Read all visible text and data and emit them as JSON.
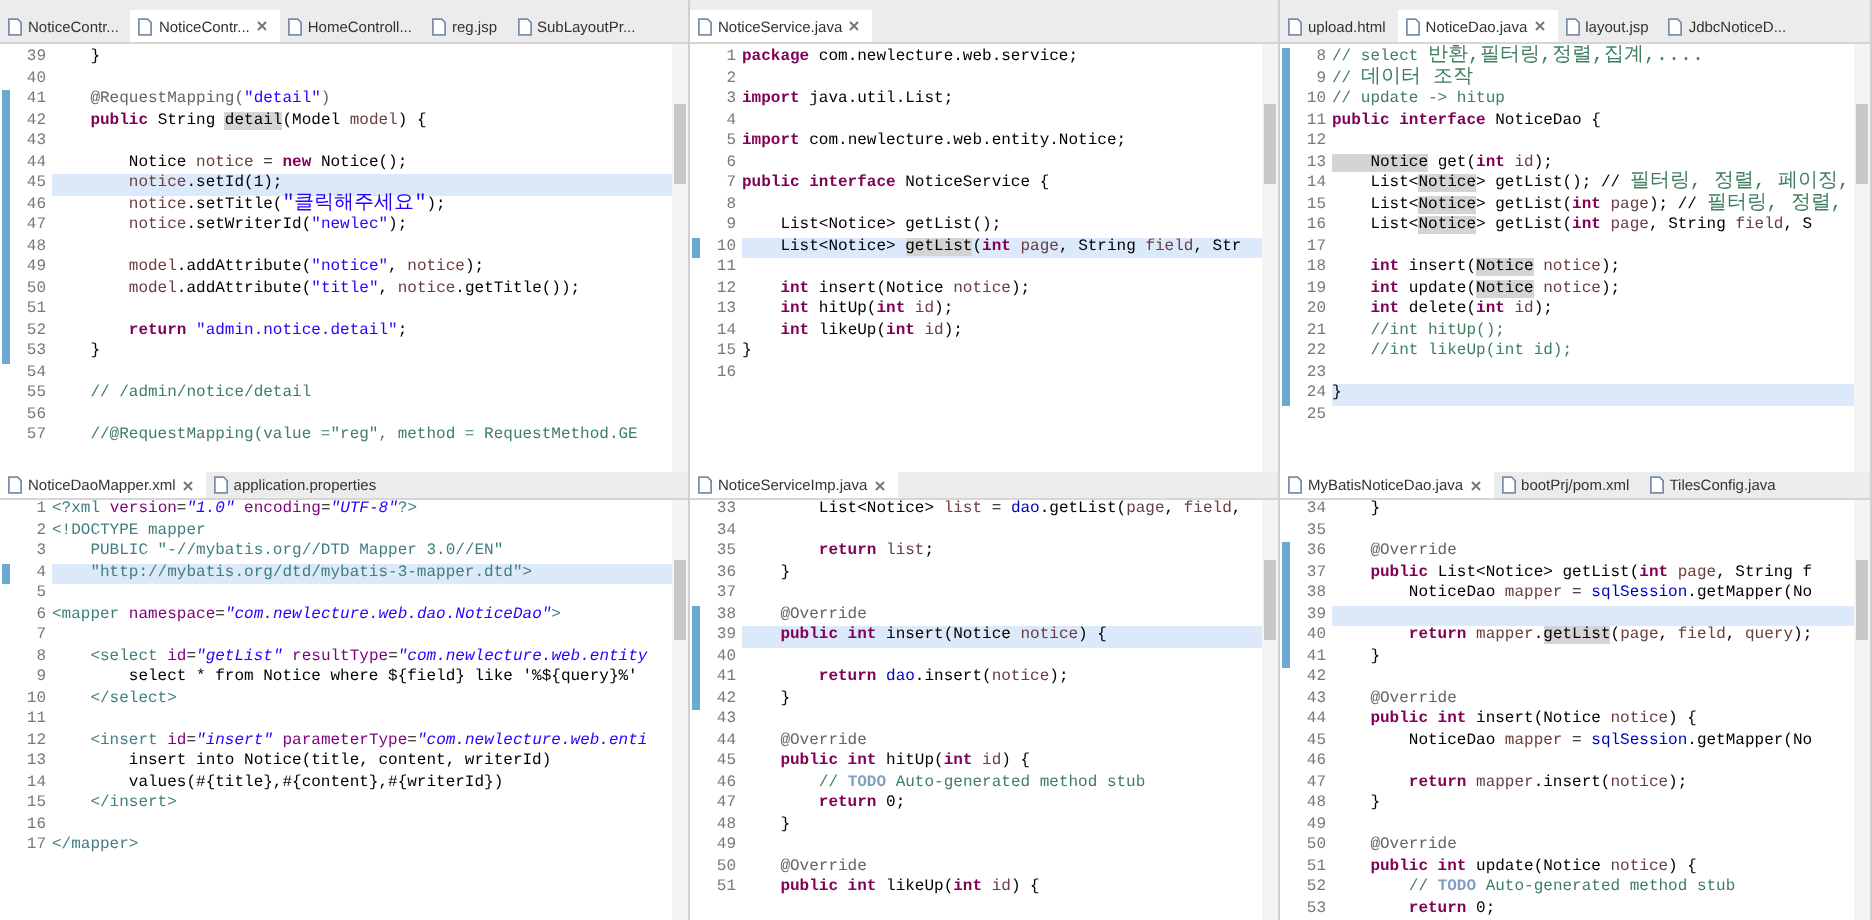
{
  "panes": [
    {
      "tabs": [
        {
          "label": "NoticeContr...",
          "selected": false
        },
        {
          "label": "NoticeContr...",
          "selected": true
        },
        {
          "label": "HomeControll...",
          "selected": false
        },
        {
          "label": "reg.jsp",
          "selected": false
        },
        {
          "label": "SubLayoutPr...",
          "selected": false
        }
      ],
      "lines": [
        {
          "n": "39",
          "changed": false,
          "current": false,
          "code": [
            {
              "text": "    }",
              "kind": "plain"
            }
          ]
        },
        {
          "n": "40",
          "changed": false,
          "current": false
        },
        {
          "n": "41",
          "changed": true,
          "current": false,
          "code": [
            {
              "text": "    @RequestMapping(",
              "kind": "annotation"
            },
            {
              "text": "\"detail\"",
              "kind": "string"
            },
            {
              "text": ")",
              "kind": "annotation"
            }
          ]
        },
        {
          "n": "42",
          "changed": true,
          "current": false,
          "code": [
            {
              "text": "    public",
              "kind": "keyword"
            },
            {
              "text": " String ",
              "kind": "plain"
            },
            {
              "text": "detail",
              "kind": "occurrence"
            },
            {
              "text": "(Model ",
              "kind": "plain"
            },
            {
              "text": "model",
              "kind": "variable"
            },
            {
              "text": ") {",
              "kind": "plain"
            }
          ]
        },
        {
          "n": "43",
          "changed": true,
          "current": false
        },
        {
          "n": "44",
          "changed": true,
          "current": false,
          "code": [
            {
              "text": "        Notice ",
              "kind": "plain"
            },
            {
              "text": "notice",
              "kind": "variable"
            },
            {
              "text": " = ",
              "kind": "plain"
            },
            {
              "text": "new",
              "kind": "keyword"
            },
            {
              "text": " Notice();",
              "kind": "plain"
            }
          ]
        },
        {
          "n": "45",
          "changed": true,
          "current": true,
          "code": [
            {
              "text": "        notice",
              "kind": "variable"
            },
            {
              "text": ".setId(1);",
              "kind": "plain"
            }
          ]
        },
        {
          "n": "46",
          "changed": true,
          "current": false,
          "code": [
            {
              "text": "        notice",
              "kind": "variable"
            },
            {
              "text": ".setTitle(",
              "kind": "plain"
            },
            {
              "text": "\"클릭해주세요\"",
              "kind": "korean-string"
            },
            {
              "text": ");",
              "kind": "plain"
            }
          ]
        },
        {
          "n": "47",
          "changed": true,
          "current": false,
          "code": [
            {
              "text": "        notice",
              "kind": "variable"
            },
            {
              "text": ".setWriterId(",
              "kind": "plain"
            },
            {
              "text": "\"newlec\"",
              "kind": "string"
            },
            {
              "text": ");",
              "kind": "plain"
            }
          ]
        },
        {
          "n": "48",
          "changed": true,
          "current": false
        },
        {
          "n": "49",
          "changed": true,
          "current": false,
          "code": [
            {
              "text": "        model",
              "kind": "variable"
            },
            {
              "text": ".addAttribute(",
              "kind": "plain"
            },
            {
              "text": "\"notice\"",
              "kind": "string"
            },
            {
              "text": ", ",
              "kind": "plain"
            },
            {
              "text": "notice",
              "kind": "variable"
            },
            {
              "text": ");",
              "kind": "plain"
            }
          ]
        },
        {
          "n": "50",
          "changed": true,
          "current": false,
          "code": [
            {
              "text": "        model",
              "kind": "variable"
            },
            {
              "text": ".addAttribute(",
              "kind": "plain"
            },
            {
              "text": "\"title\"",
              "kind": "string"
            },
            {
              "text": ", ",
              "kind": "plain"
            },
            {
              "text": "notice",
              "kind": "variable"
            },
            {
              "text": ".getTitle());",
              "kind": "plain"
            }
          ]
        },
        {
          "n": "51",
          "changed": true,
          "current": false
        },
        {
          "n": "52",
          "changed": true,
          "current": false,
          "code": [
            {
              "text": "        return",
              "kind": "keyword"
            },
            {
              "text": " \"admin.notice.detail\"",
              "kind": "string"
            },
            {
              "text": ";",
              "kind": "plain"
            }
          ]
        },
        {
          "n": "53",
          "changed": true,
          "current": false,
          "code": [
            {
              "text": "    }",
              "kind": "plain"
            }
          ]
        },
        {
          "n": "54",
          "changed": false,
          "current": false
        },
        {
          "n": "55",
          "changed": false,
          "current": false,
          "code": [
            {
              "text": "    // /admin/notice/detail",
              "kind": "comment"
            }
          ]
        },
        {
          "n": "56",
          "changed": false,
          "current": false
        },
        {
          "n": "57",
          "changed": false,
          "current": false,
          "code": [
            {
              "text": "    //@RequestMapping(value =\"reg\", method = RequestMethod.GE",
              "kind": "comment"
            }
          ]
        }
      ]
    },
    {
      "tabs": [
        {
          "label": "NoticeService.java",
          "selected": true
        }
      ],
      "lines": [
        {
          "n": "1",
          "changed": false,
          "current": false,
          "code": [
            {
              "text": "package",
              "kind": "keyword"
            },
            {
              "text": " com.newlecture.web.service;",
              "kind": "plain"
            }
          ]
        },
        {
          "n": "2",
          "changed": false,
          "current": false
        },
        {
          "n": "3",
          "changed": false,
          "current": false,
          "code": [
            {
              "text": "import",
              "kind": "keyword"
            },
            {
              "text": " java.util.List;",
              "kind": "plain"
            }
          ]
        },
        {
          "n": "4",
          "changed": false,
          "current": false
        },
        {
          "n": "5",
          "changed": false,
          "current": false,
          "code": [
            {
              "text": "import",
              "kind": "keyword"
            },
            {
              "text": " com.newlecture.web.entity.Notice;",
              "kind": "plain"
            }
          ]
        },
        {
          "n": "6",
          "changed": false,
          "current": false
        },
        {
          "n": "7",
          "changed": false,
          "current": false,
          "code": [
            {
              "text": "public interface",
              "kind": "keyword"
            },
            {
              "text": " NoticeService {",
              "kind": "plain"
            }
          ]
        },
        {
          "n": "8",
          "changed": false,
          "current": false
        },
        {
          "n": "9",
          "changed": false,
          "current": false,
          "code": [
            {
              "text": "    List<Notice> getList();",
              "kind": "plain"
            }
          ]
        },
        {
          "n": "10",
          "changed": true,
          "current": true,
          "code": [
            {
              "text": "    List<Notice> ",
              "kind": "plain"
            },
            {
              "text": "getList",
              "kind": "occurrence"
            },
            {
              "text": "(",
              "kind": "plain"
            },
            {
              "text": "int",
              "kind": "keyword"
            },
            {
              "text": " page",
              "kind": "variable"
            },
            {
              "text": ", String ",
              "kind": "plain"
            },
            {
              "text": "field",
              "kind": "variable"
            },
            {
              "text": ", Str",
              "kind": "plain"
            }
          ]
        },
        {
          "n": "11",
          "changed": false,
          "current": false
        },
        {
          "n": "12",
          "changed": false,
          "current": false,
          "code": [
            {
              "text": "    int",
              "kind": "keyword"
            },
            {
              "text": " insert(Notice ",
              "kind": "plain"
            },
            {
              "text": "notice",
              "kind": "variable"
            },
            {
              "text": ");",
              "kind": "plain"
            }
          ]
        },
        {
          "n": "13",
          "changed": false,
          "current": false,
          "code": [
            {
              "text": "    int",
              "kind": "keyword"
            },
            {
              "text": " hitUp(",
              "kind": "plain"
            },
            {
              "text": "int",
              "kind": "keyword"
            },
            {
              "text": " id",
              "kind": "variable"
            },
            {
              "text": ");",
              "kind": "plain"
            }
          ]
        },
        {
          "n": "14",
          "changed": false,
          "current": false,
          "code": [
            {
              "text": "    int",
              "kind": "keyword"
            },
            {
              "text": " likeUp(",
              "kind": "plain"
            },
            {
              "text": "int",
              "kind": "keyword"
            },
            {
              "text": " id",
              "kind": "variable"
            },
            {
              "text": ");",
              "kind": "plain"
            }
          ]
        },
        {
          "n": "15",
          "changed": false,
          "current": false,
          "code": [
            {
              "text": "}",
              "kind": "plain"
            }
          ]
        },
        {
          "n": "16",
          "changed": false,
          "current": false
        }
      ]
    },
    {
      "tabs": [
        {
          "label": "upload.html",
          "selected": false
        },
        {
          "label": "NoticeDao.java",
          "selected": true
        },
        {
          "label": "layout.jsp",
          "selected": false
        },
        {
          "label": "JdbcNoticeD...",
          "selected": false
        }
      ],
      "lines": [
        {
          "n": "8",
          "changed": true,
          "current": false,
          "code": [
            {
              "text": "// select ",
              "kind": "comment"
            },
            {
              "text": "반환,필터링,정렬,집계,....",
              "kind": "korean-comment"
            }
          ]
        },
        {
          "n": "9",
          "changed": true,
          "current": false,
          "code": [
            {
              "text": "// ",
              "kind": "comment"
            },
            {
              "text": "데이터 조작",
              "kind": "korean-comment"
            }
          ]
        },
        {
          "n": "10",
          "changed": true,
          "current": false,
          "code": [
            {
              "text": "// update -> hitup",
              "kind": "comment"
            }
          ]
        },
        {
          "n": "11",
          "changed": true,
          "current": false,
          "code": [
            {
              "text": "public interface",
              "kind": "keyword"
            },
            {
              "text": " NoticeDao {",
              "kind": "plain"
            }
          ]
        },
        {
          "n": "12",
          "changed": true,
          "current": false
        },
        {
          "n": "13",
          "changed": true,
          "current": false,
          "code": [
            {
              "text": "    Notice",
              "kind": "occurrence"
            },
            {
              "text": " get(",
              "kind": "plain"
            },
            {
              "text": "int",
              "kind": "keyword"
            },
            {
              "text": " id",
              "kind": "variable"
            },
            {
              "text": ");",
              "kind": "plain"
            }
          ]
        },
        {
          "n": "14",
          "changed": true,
          "current": false,
          "code": [
            {
              "text": "    List<",
              "kind": "plain"
            },
            {
              "text": "Notice",
              "kind": "occurrence"
            },
            {
              "text": "> getList(); // ",
              "kind": "plain"
            },
            {
              "text": "필터링, 정렬, 페이징,",
              "kind": "korean-comment"
            }
          ]
        },
        {
          "n": "15",
          "changed": true,
          "current": false,
          "code": [
            {
              "text": "    List<",
              "kind": "plain"
            },
            {
              "text": "Notice",
              "kind": "occurrence"
            },
            {
              "text": "> getList(",
              "kind": "plain"
            },
            {
              "text": "int",
              "kind": "keyword"
            },
            {
              "text": " page",
              "kind": "variable"
            },
            {
              "text": "); // ",
              "kind": "plain"
            },
            {
              "text": "필터링, 정렬,",
              "kind": "korean-comment"
            }
          ]
        },
        {
          "n": "16",
          "changed": true,
          "current": false,
          "code": [
            {
              "text": "    List<",
              "kind": "plain"
            },
            {
              "text": "Notice",
              "kind": "occurrence"
            },
            {
              "text": "> getList(",
              "kind": "plain"
            },
            {
              "text": "int",
              "kind": "keyword"
            },
            {
              "text": " page",
              "kind": "variable"
            },
            {
              "text": ", String ",
              "kind": "plain"
            },
            {
              "text": "field",
              "kind": "variable"
            },
            {
              "text": ", S",
              "kind": "plain"
            }
          ]
        },
        {
          "n": "17",
          "changed": true,
          "current": false
        },
        {
          "n": "18",
          "changed": true,
          "current": false,
          "code": [
            {
              "text": "    int",
              "kind": "keyword"
            },
            {
              "text": " insert(",
              "kind": "plain"
            },
            {
              "text": "Notice",
              "kind": "occurrence"
            },
            {
              "text": " notice",
              "kind": "variable"
            },
            {
              "text": ");",
              "kind": "plain"
            }
          ]
        },
        {
          "n": "19",
          "changed": true,
          "current": false,
          "code": [
            {
              "text": "    int",
              "kind": "keyword"
            },
            {
              "text": " update(",
              "kind": "plain"
            },
            {
              "text": "Notice",
              "kind": "occurrence"
            },
            {
              "text": " notice",
              "kind": "variable"
            },
            {
              "text": ");",
              "kind": "plain"
            }
          ]
        },
        {
          "n": "20",
          "changed": true,
          "current": false,
          "code": [
            {
              "text": "    int",
              "kind": "keyword"
            },
            {
              "text": " delete(",
              "kind": "plain"
            },
            {
              "text": "int",
              "kind": "keyword"
            },
            {
              "text": " id",
              "kind": "variable"
            },
            {
              "text": ");",
              "kind": "plain"
            }
          ]
        },
        {
          "n": "21",
          "changed": true,
          "current": false,
          "code": [
            {
              "text": "    //int hitUp();",
              "kind": "comment"
            }
          ]
        },
        {
          "n": "22",
          "changed": true,
          "current": false,
          "code": [
            {
              "text": "    //int likeUp(int id);",
              "kind": "comment"
            }
          ]
        },
        {
          "n": "23",
          "changed": true,
          "current": false
        },
        {
          "n": "24",
          "changed": true,
          "current": true,
          "code": [
            {
              "text": "}",
              "kind": "plain"
            }
          ]
        },
        {
          "n": "25",
          "changed": false,
          "current": false
        }
      ]
    },
    {
      "tabs": [
        {
          "label": "NoticeDaoMapper.xml",
          "selected": true
        },
        {
          "label": "application.properties",
          "selected": false
        }
      ],
      "lines": [
        {
          "n": "1",
          "changed": false,
          "current": false,
          "code": [
            {
              "text": "<?xml",
              "kind": "tag"
            },
            {
              "text": " version",
              "kind": "attribute"
            },
            {
              "text": "=",
              "kind": "plain"
            },
            {
              "text": "\"1.0\"",
              "kind": "attribute-value"
            },
            {
              "text": " encoding",
              "kind": "attribute"
            },
            {
              "text": "=",
              "kind": "plain"
            },
            {
              "text": "\"UTF-8\"",
              "kind": "attribute-value"
            },
            {
              "text": "?>",
              "kind": "tag"
            }
          ]
        },
        {
          "n": "2",
          "changed": false,
          "current": false,
          "code": [
            {
              "text": "<!DOCTYPE mapper",
              "kind": "tag"
            }
          ]
        },
        {
          "n": "3",
          "changed": false,
          "current": false,
          "code": [
            {
              "text": "    PUBLIC \"-//mybatis.org//DTD Mapper 3.0//EN\"",
              "kind": "tag"
            }
          ]
        },
        {
          "n": "4",
          "changed": true,
          "current": true,
          "code": [
            {
              "text": "    \"http://mybatis.org/dtd/mybatis-3-mapper.dtd\">",
              "kind": "tag"
            }
          ]
        },
        {
          "n": "5",
          "changed": false,
          "current": false
        },
        {
          "n": "6",
          "changed": false,
          "current": false,
          "code": [
            {
              "text": "<mapper",
              "kind": "tag"
            },
            {
              "text": " namespace",
              "kind": "attribute"
            },
            {
              "text": "=",
              "kind": "plain"
            },
            {
              "text": "\"com.newlecture.web.dao.NoticeDao\"",
              "kind": "attribute-value"
            },
            {
              "text": ">",
              "kind": "tag"
            }
          ]
        },
        {
          "n": "7",
          "changed": false,
          "current": false
        },
        {
          "n": "8",
          "changed": false,
          "current": false,
          "code": [
            {
              "text": "    <select",
              "kind": "tag"
            },
            {
              "text": " id",
              "kind": "attribute"
            },
            {
              "text": "=",
              "kind": "plain"
            },
            {
              "text": "\"getList\"",
              "kind": "attribute-value"
            },
            {
              "text": " resultType",
              "kind": "attribute"
            },
            {
              "text": "=",
              "kind": "plain"
            },
            {
              "text": "\"com.newlecture.web.entity",
              "kind": "attribute-value"
            }
          ]
        },
        {
          "n": "9",
          "changed": false,
          "current": false,
          "code": [
            {
              "text": "        select * from Notice where ${field} like '%${query}%'",
              "kind": "plain"
            }
          ]
        },
        {
          "n": "10",
          "changed": false,
          "current": false,
          "code": [
            {
              "text": "    </select>",
              "kind": "tag"
            }
          ]
        },
        {
          "n": "11",
          "changed": false,
          "current": false
        },
        {
          "n": "12",
          "changed": false,
          "current": false,
          "code": [
            {
              "text": "    <insert",
              "kind": "tag"
            },
            {
              "text": " id",
              "kind": "attribute"
            },
            {
              "text": "=",
              "kind": "plain"
            },
            {
              "text": "\"insert\"",
              "kind": "attribute-value"
            },
            {
              "text": " parameterType",
              "kind": "attribute"
            },
            {
              "text": "=",
              "kind": "plain"
            },
            {
              "text": "\"com.newlecture.web.enti",
              "kind": "attribute-value"
            }
          ]
        },
        {
          "n": "13",
          "changed": false,
          "current": false,
          "code": [
            {
              "text": "        insert into Notice(title, content, writerId)",
              "kind": "plain"
            }
          ]
        },
        {
          "n": "14",
          "changed": false,
          "current": false,
          "code": [
            {
              "text": "        values(#{title},#{content},#{writerId})",
              "kind": "plain"
            }
          ]
        },
        {
          "n": "15",
          "changed": false,
          "current": false,
          "code": [
            {
              "text": "    </insert>",
              "kind": "tag"
            }
          ]
        },
        {
          "n": "16",
          "changed": false,
          "current": false
        },
        {
          "n": "17",
          "changed": false,
          "current": false,
          "code": [
            {
              "text": "</mapper>",
              "kind": "tag"
            }
          ]
        }
      ]
    },
    {
      "tabs": [
        {
          "label": "NoticeServiceImp.java",
          "selected": true
        }
      ],
      "lines": [
        {
          "n": "33",
          "changed": false,
          "current": false,
          "code": [
            {
              "text": "        List<Notice> ",
              "kind": "plain"
            },
            {
              "text": "list",
              "kind": "variable"
            },
            {
              "text": " = ",
              "kind": "plain"
            },
            {
              "text": "dao",
              "kind": "field"
            },
            {
              "text": ".getList(",
              "kind": "plain"
            },
            {
              "text": "page",
              "kind": "variable"
            },
            {
              "text": ", ",
              "kind": "plain"
            },
            {
              "text": "field",
              "kind": "variable"
            },
            {
              "text": ",",
              "kind": "plain"
            }
          ]
        },
        {
          "n": "34",
          "changed": false,
          "current": false
        },
        {
          "n": "35",
          "changed": false,
          "current": false,
          "code": [
            {
              "text": "        return",
              "kind": "keyword"
            },
            {
              "text": " list",
              "kind": "variable"
            },
            {
              "text": ";",
              "kind": "plain"
            }
          ]
        },
        {
          "n": "36",
          "changed": false,
          "current": false,
          "code": [
            {
              "text": "    }",
              "kind": "plain"
            }
          ]
        },
        {
          "n": "37",
          "changed": false,
          "current": false
        },
        {
          "n": "38",
          "changed": true,
          "current": false,
          "code": [
            {
              "text": "    @Override",
              "kind": "annotation"
            }
          ]
        },
        {
          "n": "39",
          "changed": true,
          "current": true,
          "code": [
            {
              "text": "    public int",
              "kind": "keyword"
            },
            {
              "text": " insert(Notice ",
              "kind": "plain"
            },
            {
              "text": "notice",
              "kind": "variable"
            },
            {
              "text": ") {",
              "kind": "plain"
            }
          ]
        },
        {
          "n": "40",
          "changed": true,
          "current": false
        },
        {
          "n": "41",
          "changed": true,
          "current": false,
          "code": [
            {
              "text": "        return",
              "kind": "keyword"
            },
            {
              "text": " dao",
              "kind": "field"
            },
            {
              "text": ".insert(",
              "kind": "plain"
            },
            {
              "text": "notice",
              "kind": "variable"
            },
            {
              "text": ");",
              "kind": "plain"
            }
          ]
        },
        {
          "n": "42",
          "changed": true,
          "current": false,
          "code": [
            {
              "text": "    }",
              "kind": "plain"
            }
          ]
        },
        {
          "n": "43",
          "changed": false,
          "current": false
        },
        {
          "n": "44",
          "changed": false,
          "current": false,
          "code": [
            {
              "text": "    @Override",
              "kind": "annotation"
            }
          ]
        },
        {
          "n": "45",
          "changed": false,
          "current": false,
          "code": [
            {
              "text": "    public int",
              "kind": "keyword"
            },
            {
              "text": " hitUp(",
              "kind": "plain"
            },
            {
              "text": "int",
              "kind": "keyword"
            },
            {
              "text": " id",
              "kind": "variable"
            },
            {
              "text": ") {",
              "kind": "plain"
            }
          ]
        },
        {
          "n": "46",
          "changed": false,
          "current": false,
          "code": [
            {
              "text": "        //",
              "kind": "comment"
            },
            {
              "text": " TODO",
              "kind": "task"
            },
            {
              "text": " Auto-generated method stub",
              "kind": "comment"
            }
          ]
        },
        {
          "n": "47",
          "changed": false,
          "current": false,
          "code": [
            {
              "text": "        return",
              "kind": "keyword"
            },
            {
              "text": " 0;",
              "kind": "plain"
            }
          ]
        },
        {
          "n": "48",
          "changed": false,
          "current": false,
          "code": [
            {
              "text": "    }",
              "kind": "plain"
            }
          ]
        },
        {
          "n": "49",
          "changed": false,
          "current": false
        },
        {
          "n": "50",
          "changed": false,
          "current": false,
          "code": [
            {
              "text": "    @Override",
              "kind": "annotation"
            }
          ]
        },
        {
          "n": "51",
          "changed": false,
          "current": false,
          "code": [
            {
              "text": "    public int",
              "kind": "keyword"
            },
            {
              "text": " likeUp(",
              "kind": "plain"
            },
            {
              "text": "int",
              "kind": "keyword"
            },
            {
              "text": " id",
              "kind": "variable"
            },
            {
              "text": ") {",
              "kind": "plain"
            }
          ]
        }
      ]
    },
    {
      "tabs": [
        {
          "label": "MyBatisNoticeDao.java",
          "selected": true
        },
        {
          "label": "bootPrj/pom.xml",
          "selected": false
        },
        {
          "label": "TilesConfig.java",
          "selected": false
        }
      ],
      "lines": [
        {
          "n": "34",
          "changed": false,
          "current": false,
          "code": [
            {
              "text": "    }",
              "kind": "plain"
            }
          ]
        },
        {
          "n": "35",
          "changed": false,
          "current": false
        },
        {
          "n": "36",
          "changed": true,
          "current": false,
          "code": [
            {
              "text": "    @Override",
              "kind": "annotation"
            }
          ]
        },
        {
          "n": "37",
          "changed": true,
          "current": false,
          "code": [
            {
              "text": "    public",
              "kind": "keyword"
            },
            {
              "text": " List<Notice> getList(",
              "kind": "plain"
            },
            {
              "text": "int",
              "kind": "keyword"
            },
            {
              "text": " page",
              "kind": "variable"
            },
            {
              "text": ", String f",
              "kind": "plain"
            }
          ]
        },
        {
          "n": "38",
          "changed": true,
          "current": false,
          "code": [
            {
              "text": "        NoticeDao ",
              "kind": "plain"
            },
            {
              "text": "mapper",
              "kind": "variable"
            },
            {
              "text": " = ",
              "kind": "plain"
            },
            {
              "text": "sqlSession",
              "kind": "field"
            },
            {
              "text": ".getMapper(No",
              "kind": "plain"
            }
          ]
        },
        {
          "n": "39",
          "changed": true,
          "current": true
        },
        {
          "n": "40",
          "changed": true,
          "current": false,
          "code": [
            {
              "text": "        return",
              "kind": "keyword"
            },
            {
              "text": " mapper",
              "kind": "variable"
            },
            {
              "text": ".",
              "kind": "plain"
            },
            {
              "text": "getList",
              "kind": "occurrence"
            },
            {
              "text": "(",
              "kind": "plain"
            },
            {
              "text": "page",
              "kind": "variable"
            },
            {
              "text": ", ",
              "kind": "plain"
            },
            {
              "text": "field",
              "kind": "variable"
            },
            {
              "text": ", ",
              "kind": "plain"
            },
            {
              "text": "query",
              "kind": "variable"
            },
            {
              "text": ");",
              "kind": "plain"
            }
          ]
        },
        {
          "n": "41",
          "changed": true,
          "current": false,
          "code": [
            {
              "text": "    }",
              "kind": "plain"
            }
          ]
        },
        {
          "n": "42",
          "changed": false,
          "current": false
        },
        {
          "n": "43",
          "changed": false,
          "current": false,
          "code": [
            {
              "text": "    @Override",
              "kind": "annotation"
            }
          ]
        },
        {
          "n": "44",
          "changed": false,
          "current": false,
          "code": [
            {
              "text": "    public int",
              "kind": "keyword"
            },
            {
              "text": " insert(Notice ",
              "kind": "plain"
            },
            {
              "text": "notice",
              "kind": "variable"
            },
            {
              "text": ") {",
              "kind": "plain"
            }
          ]
        },
        {
          "n": "45",
          "changed": false,
          "current": false,
          "code": [
            {
              "text": "        NoticeDao ",
              "kind": "plain"
            },
            {
              "text": "mapper",
              "kind": "variable"
            },
            {
              "text": " = ",
              "kind": "plain"
            },
            {
              "text": "sqlSession",
              "kind": "field"
            },
            {
              "text": ".getMapper(No",
              "kind": "plain"
            }
          ]
        },
        {
          "n": "46",
          "changed": false,
          "current": false
        },
        {
          "n": "47",
          "changed": false,
          "current": false,
          "code": [
            {
              "text": "        return",
              "kind": "keyword"
            },
            {
              "text": " mapper",
              "kind": "variable"
            },
            {
              "text": ".insert(",
              "kind": "plain"
            },
            {
              "text": "notice",
              "kind": "variable"
            },
            {
              "text": ");",
              "kind": "plain"
            }
          ]
        },
        {
          "n": "48",
          "changed": false,
          "current": false,
          "code": [
            {
              "text": "    }",
              "kind": "plain"
            }
          ]
        },
        {
          "n": "49",
          "changed": false,
          "current": false
        },
        {
          "n": "50",
          "changed": false,
          "current": false,
          "code": [
            {
              "text": "    @Override",
              "kind": "annotation"
            }
          ]
        },
        {
          "n": "51",
          "changed": false,
          "current": false,
          "code": [
            {
              "text": "    public int",
              "kind": "keyword"
            },
            {
              "text": " update(Notice ",
              "kind": "plain"
            },
            {
              "text": "notice",
              "kind": "variable"
            },
            {
              "text": ") {",
              "kind": "plain"
            }
          ]
        },
        {
          "n": "52",
          "changed": false,
          "current": false,
          "code": [
            {
              "text": "        //",
              "kind": "comment"
            },
            {
              "text": " TODO",
              "kind": "task"
            },
            {
              "text": " Auto-generated method stub",
              "kind": "comment"
            }
          ]
        },
        {
          "n": "53",
          "changed": false,
          "current": false,
          "code": [
            {
              "text": "        return",
              "kind": "keyword"
            },
            {
              "text": " 0;",
              "kind": "plain"
            }
          ]
        }
      ]
    }
  ]
}
